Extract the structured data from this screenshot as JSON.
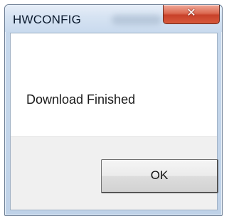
{
  "window": {
    "title": "HWCONFIG"
  },
  "titlebar": {
    "close_icon": "close-icon",
    "close_glyph": "✕",
    "close_color": "#c8412a"
  },
  "dialog": {
    "message": "Download Finished",
    "ok_label": "OK"
  }
}
